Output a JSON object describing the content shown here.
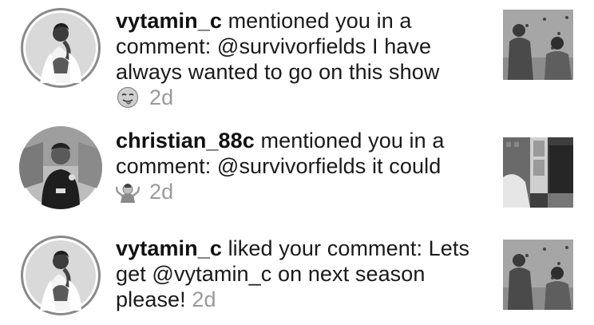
{
  "notifications": [
    {
      "username": "vytamin_c",
      "message": " mentioned you in a comment: @survivorfields I have always wanted to go on this show",
      "emoji": "tongue-emoji",
      "time": "2d",
      "avatar": "vytamin-c-avatar",
      "thumbnail": "post-thumbnail-climbing-wall"
    },
    {
      "username": "christian_88c",
      "message": " mentioned you in a comment: @survivorfields it could",
      "emoji": "shrug-emoji",
      "time": "2d",
      "avatar": "christian-88c-avatar",
      "thumbnail": "post-thumbnail-doorway"
    },
    {
      "username": "vytamin_c",
      "message": " liked your comment: Lets get @vytamin_c on next season please!",
      "emoji": "",
      "time": "2d",
      "avatar": "vytamin-c-avatar",
      "thumbnail": "post-thumbnail-climbing-wall"
    }
  ]
}
